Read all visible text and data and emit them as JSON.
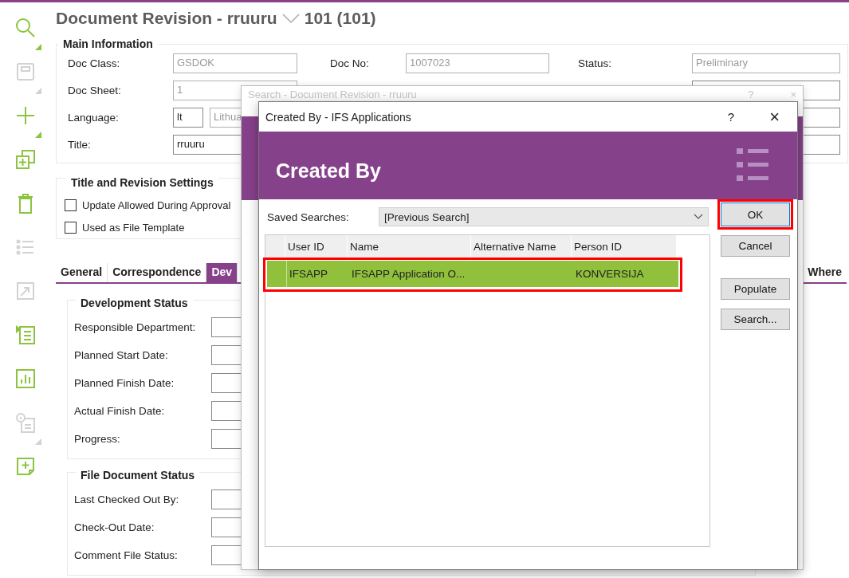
{
  "header": {
    "title": "Document Revision - rruuru",
    "revision": "101 (101)"
  },
  "sidebar": [
    {
      "kind": "search",
      "disabled": false,
      "menu_marker": true
    },
    {
      "kind": "save",
      "disabled": true,
      "menu_marker": true
    },
    {
      "kind": "new",
      "disabled": false,
      "menu_marker": true
    },
    {
      "kind": "duplicate",
      "disabled": false,
      "menu_marker": false
    },
    {
      "kind": "delete",
      "disabled": false,
      "menu_marker": false
    },
    {
      "kind": "list",
      "disabled": true,
      "menu_marker": false
    },
    {
      "kind": "open",
      "disabled": true,
      "menu_marker": false
    },
    {
      "kind": "outline",
      "disabled": false,
      "menu_marker": false
    },
    {
      "kind": "chart",
      "disabled": false,
      "menu_marker": false
    },
    {
      "kind": "info",
      "disabled": true,
      "menu_marker": true
    },
    {
      "kind": "note",
      "disabled": false,
      "menu_marker": false
    }
  ],
  "main_information": {
    "heading": "Main Information",
    "rows": [
      {
        "col1": {
          "label": "Doc Class:",
          "inputs": [
            {
              "value": "GSDOK",
              "read_only": true
            }
          ]
        },
        "col2": {
          "label": "Doc No:",
          "inputs": [
            {
              "value": "1007023",
              "read_only": true
            }
          ]
        },
        "col3": {
          "label": "Status:",
          "inputs": [
            {
              "value": "Preliminary",
              "read_only": true
            }
          ]
        }
      },
      {
        "col1": {
          "label": "Doc Sheet:",
          "inputs": [
            {
              "value": "1",
              "read_only": true
            }
          ]
        },
        "col3": {
          "inputs": [
            {
              "read_only": false
            }
          ]
        }
      },
      {
        "col1": {
          "label": "Language:",
          "inputs": [
            {
              "value": "lt",
              "read_only": false
            },
            {
              "value": "Lithua",
              "read_only": true
            }
          ]
        },
        "col3": {
          "inputs": [
            {
              "read_only": false
            }
          ]
        }
      },
      {
        "col1": {
          "label": "Title:",
          "inputs": [
            {
              "value": "rruuru",
              "read_only": false
            }
          ]
        },
        "col3": {
          "inputs": [
            {
              "read_only": false
            }
          ]
        }
      }
    ]
  },
  "title_settings": {
    "heading": "Title and Revision Settings",
    "options": [
      {
        "label": "Update Allowed During Approval",
        "checked": false
      },
      {
        "label": "Used as File Template",
        "checked": false
      }
    ]
  },
  "tabs": [
    {
      "label": "General",
      "selected": false
    },
    {
      "label": "Correspondence",
      "selected": false
    },
    {
      "label": "Dev",
      "selected": true
    },
    {
      "label": "Where",
      "selected": false
    }
  ],
  "development_status": {
    "heading": "Development Status",
    "fields": [
      {
        "label": "Responsible Department:"
      },
      {
        "label": "Planned Start Date:"
      },
      {
        "label": "Planned Finish Date:"
      },
      {
        "label": "Actual Finish Date:"
      },
      {
        "label": "Progress:"
      }
    ]
  },
  "file_document_status": {
    "heading": "File Document Status",
    "fields": [
      {
        "label": "Last Checked Out By:"
      },
      {
        "label": "Check-Out Date:"
      },
      {
        "label": "Comment File Status:"
      }
    ]
  },
  "search_dialog": {
    "title": "Search - Document Revision - rruuru",
    "help": "?",
    "close": "×"
  },
  "created_by_dialog": {
    "title": "Created By - IFS Applications",
    "help": "?",
    "close": "×",
    "heading": "Created By",
    "saved_searches": {
      "label": "Saved Searches:",
      "value": "[Previous Search]"
    },
    "table": {
      "columns": [
        "User ID",
        "Name",
        "Alternative Name",
        "Person ID"
      ],
      "rows": [
        {
          "cells": [
            "IFSAPP",
            "IFSAPP Application O...",
            null,
            "KONVERSIJA"
          ],
          "selected": true,
          "highlighted": true
        }
      ]
    },
    "buttons": [
      {
        "label": "OK",
        "focused": true,
        "highlighted": true
      },
      {
        "label": "Cancel",
        "focused": false,
        "highlighted": false
      },
      {
        "label": "Populate",
        "focused": false,
        "highlighted": false
      },
      {
        "label": "Search...",
        "focused": false,
        "highlighted": false
      }
    ]
  }
}
